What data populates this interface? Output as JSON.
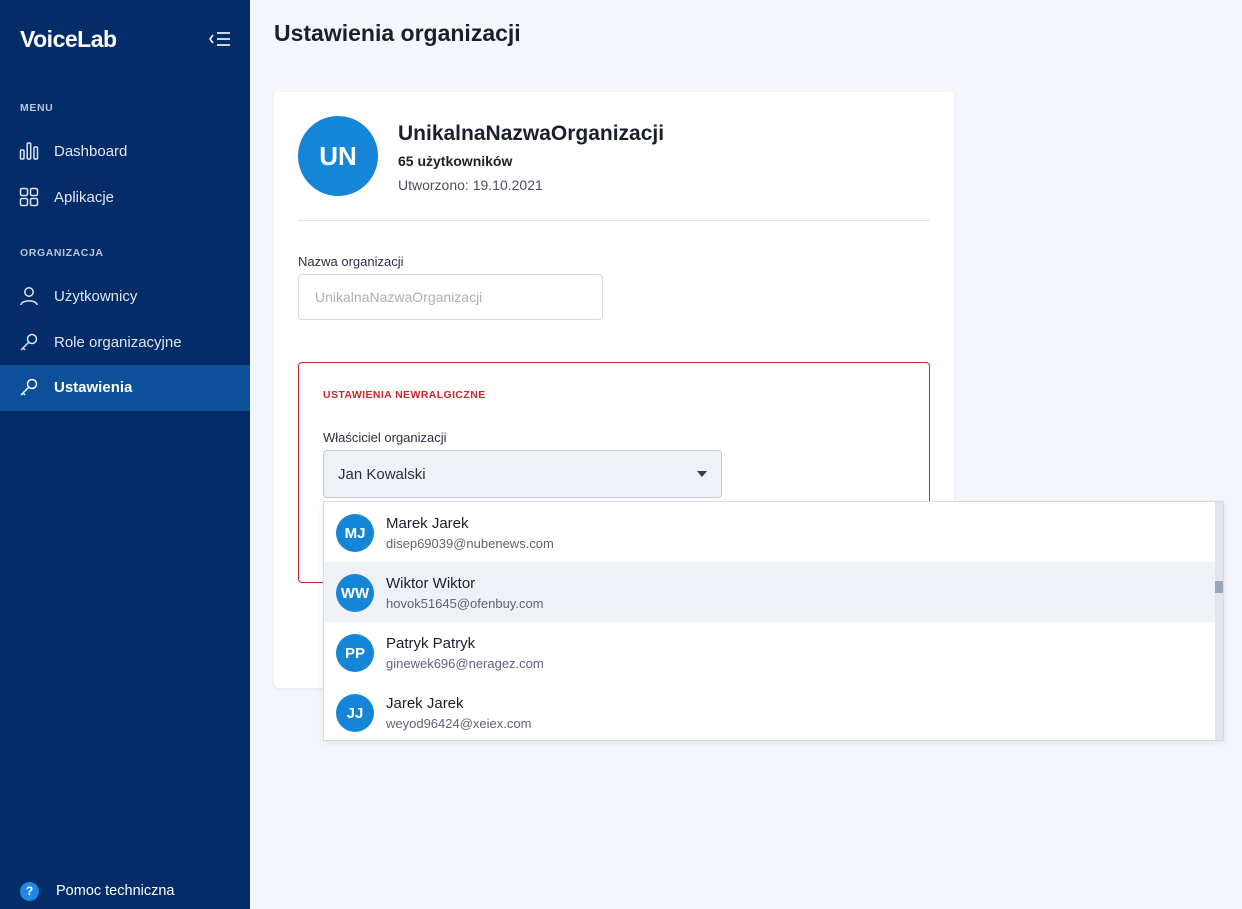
{
  "sidebar": {
    "logo": "VoiceLab",
    "menu_label": "MENU",
    "organization_label": "ORGANIZACJA",
    "menu_items": [
      {
        "label": "Dashboard",
        "icon": "bar-chart-icon"
      },
      {
        "label": "Aplikacje",
        "icon": "grid-icon"
      }
    ],
    "org_items": [
      {
        "label": "Użytkownicy",
        "icon": "user-icon"
      },
      {
        "label": "Role organizacyjne",
        "icon": "key-icon"
      },
      {
        "label": "Ustawienia",
        "icon": "key-icon",
        "active": true
      }
    ],
    "help_label": "Pomoc techniczna",
    "help_icon_glyph": "?"
  },
  "page": {
    "title": "Ustawienia organizacji"
  },
  "org": {
    "initials": "UN",
    "name": "UnikalnaNazwaOrganizacji",
    "users": "65 użytkowników",
    "created": "Utworzono: 19.10.2021"
  },
  "form": {
    "name_label": "Nazwa organizacji",
    "name_placeholder": "UnikalnaNazwaOrganizacji",
    "name_value": ""
  },
  "danger": {
    "title": "USTAWIENIA NEWRALGICZNE",
    "owner_label": "Właściciel organizacji",
    "owner_value": "Jan Kowalski"
  },
  "dropdown": {
    "options": [
      {
        "initials": "MJ",
        "name": "Marek Jarek",
        "email": "disep69039@nubenews.com"
      },
      {
        "initials": "WW",
        "name": "Wiktor Wiktor",
        "email": "hovok51645@ofenbuy.com",
        "highlighted": true
      },
      {
        "initials": "PP",
        "name": "Patryk Patryk",
        "email": "ginewek696@neragez.com"
      },
      {
        "initials": "JJ",
        "name": "Jarek Jarek",
        "email": "weyod96424@xeiex.com"
      }
    ]
  },
  "colors": {
    "sidebar_bg": "#032c69",
    "active_item_bg": "#0b5098",
    "accent_blue": "#1585d8",
    "danger_red": "#c8282d",
    "page_bg": "#f4f6fb"
  }
}
